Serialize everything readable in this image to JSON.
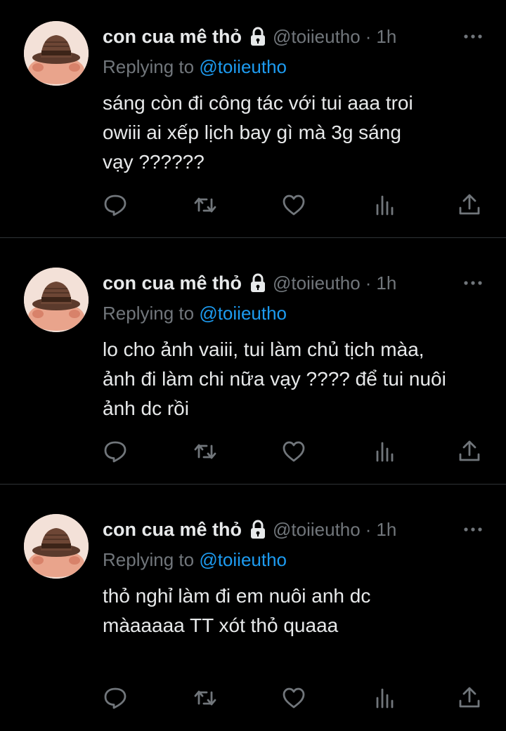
{
  "colors": {
    "background": "#000000",
    "text": "#e7e9ea",
    "secondary": "#71767b",
    "link": "#1d9bf0",
    "divider": "#2f3336"
  },
  "tweets": [
    {
      "display_name": "con cua mê thỏ",
      "handle": "@toiieutho",
      "separator": "·",
      "time": "1h",
      "replying_prefix": "Replying to ",
      "replying_to": "@toiieutho",
      "text": "sáng còn đi công tác với tui aaa troi\nowiii ai xếp lịch bay gì mà 3g sáng\nvạy ??????",
      "icons": [
        "lock-icon",
        "more-icon",
        "reply-icon",
        "retweet-icon",
        "like-icon",
        "views-icon",
        "share-icon"
      ]
    },
    {
      "display_name": "con cua mê thỏ",
      "handle": "@toiieutho",
      "separator": "·",
      "time": "1h",
      "replying_prefix": "Replying to ",
      "replying_to": "@toiieutho",
      "text": "lo cho ảnh vaiii, tui làm chủ tịch màa,\nảnh đi làm chi nữa vạy ???? để tui nuôi\nảnh dc rồi",
      "icons": [
        "lock-icon",
        "more-icon",
        "reply-icon",
        "retweet-icon",
        "like-icon",
        "views-icon",
        "share-icon"
      ]
    },
    {
      "display_name": "con cua mê thỏ",
      "handle": "@toiieutho",
      "separator": "·",
      "time": "1h",
      "replying_prefix": "Replying to ",
      "replying_to": "@toiieutho",
      "text": "thỏ nghỉ làm đi em nuôi anh dc\nmàaaaaa TT xót thỏ quaaa",
      "icons": [
        "lock-icon",
        "more-icon",
        "reply-icon",
        "retweet-icon",
        "like-icon",
        "views-icon",
        "share-icon"
      ]
    }
  ]
}
